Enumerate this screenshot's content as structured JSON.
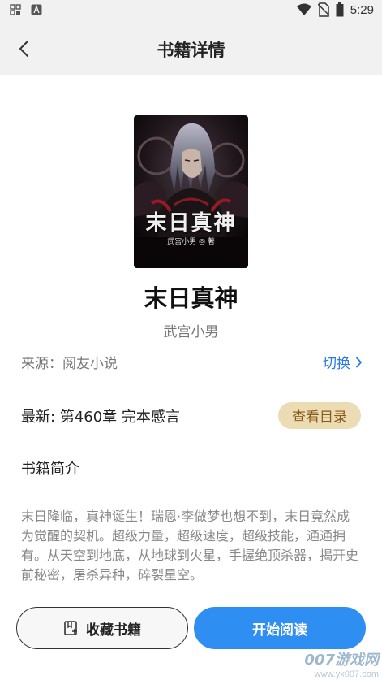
{
  "status_bar": {
    "time": "5:29",
    "left_icons": [
      "notification-grid-icon",
      "font-a-icon"
    ],
    "right_icons": [
      "wifi-icon",
      "no-sim-icon",
      "battery-icon"
    ]
  },
  "header": {
    "title": "书籍详情",
    "back_icon": "chevron-left-icon"
  },
  "book": {
    "cover_title": "末日真神",
    "cover_author": "武宫小男 ◎ 著",
    "title": "末日真神",
    "author": "武宫小男",
    "source": "来源：阅友小说",
    "switch_label": "切换",
    "latest": "最新: 第460章 完本感言",
    "toc_label": "查看目录",
    "intro_heading": "书籍简介",
    "intro": "末日降临，真神诞生！瑞恩·李做梦也想不到，末日竟然成为觉醒的契机。超级力量，超级速度，超级技能，通通拥有。从天空到地底，从地球到火星，手握绝顶杀器，揭开史前秘密，屠杀异种，碎裂星空。"
  },
  "actions": {
    "favorite_label": "收藏书籍",
    "read_label": "开始阅读"
  },
  "watermark": {
    "main": "007游戏网",
    "url": "www.yx007.com"
  },
  "colors": {
    "accent_blue": "#2e8ef2",
    "link_blue": "#2a7be4",
    "toc_bg": "#ecdcb4",
    "toc_text": "#8a5a1c"
  }
}
